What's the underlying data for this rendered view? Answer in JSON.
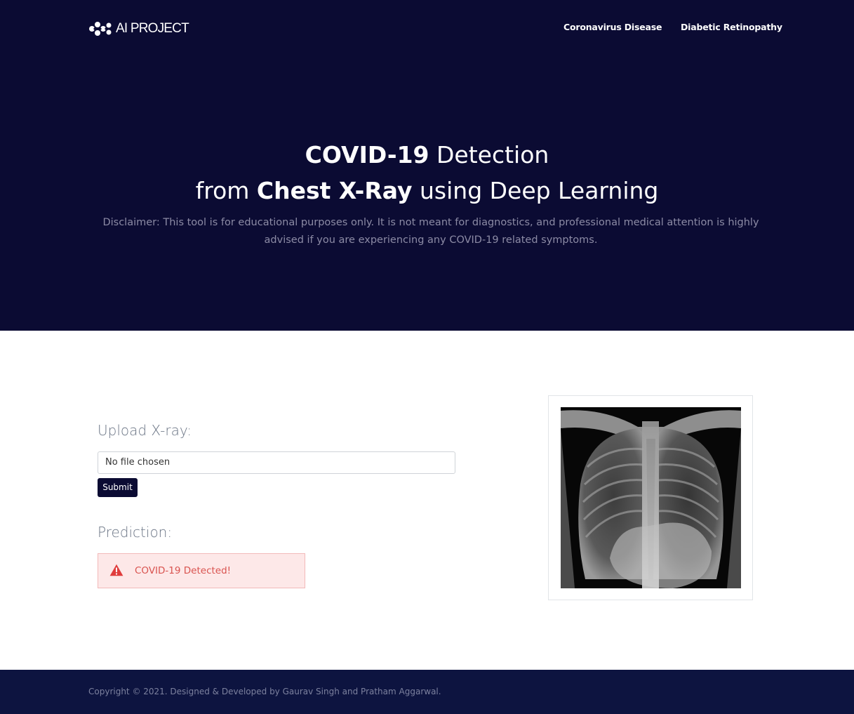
{
  "header": {
    "logo_text": "AI PROJECT",
    "nav": [
      "Coronavirus Disease",
      "Diabetic Retinopathy"
    ]
  },
  "hero": {
    "title_line1": {
      "bold": "COVID-19",
      "rest": " Detection"
    },
    "title_line2": {
      "pre": "from ",
      "bold": "Chest X-Ray",
      "post": " using Deep Learning"
    },
    "disclaimer": "Disclaimer: This tool is for educational purposes only. It is not meant for diagnostics, and professional medical attention is highly advised if you are experiencing any COVID-19 related symptoms."
  },
  "form": {
    "upload_label": "Upload X-ray:",
    "file_status": "No file chosen",
    "submit_label": "Submit"
  },
  "prediction": {
    "label": "Prediction:",
    "result": "COVID-19 Detected!",
    "icon": "warning-icon"
  },
  "footer": {
    "copyright": "Copyright © 2021. Designed & Developed by Gaurav Singh and Pratham Aggarwal."
  },
  "colors": {
    "hero_bg": "#0b0b33",
    "footer_bg": "#0d1440",
    "alert_bg": "#fde8e8",
    "alert_text": "#d9534f"
  }
}
